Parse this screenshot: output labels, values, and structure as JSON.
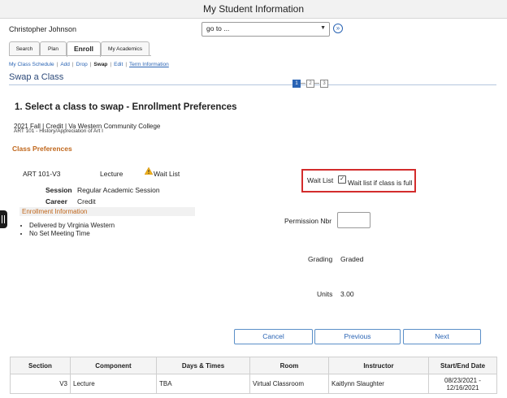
{
  "window": {
    "title": "My Student Information"
  },
  "header": {
    "user_name": "Christopher Johnson",
    "goto_value": "go to ...",
    "go_icon": "go-arrow-icon"
  },
  "tabs": [
    {
      "label": "Search"
    },
    {
      "label": "Plan"
    },
    {
      "label": "Enroll",
      "active": true
    },
    {
      "label": "My Academics"
    }
  ],
  "subnav": {
    "my_class_schedule": "My Class Schedule",
    "add": "Add",
    "drop": "Drop",
    "swap": "Swap",
    "edit": "Edit",
    "term_information": "Term Information",
    "separator": "|"
  },
  "page": {
    "title": "Swap a Class"
  },
  "steps": [
    "1",
    "2",
    "3"
  ],
  "section": {
    "heading": "1.  Select a class to swap - Enrollment Preferences",
    "term_line": "2021 Fall | Credit | Va Western Community College",
    "course_line": "ART  101 - History/Appreciation of Art I"
  },
  "preferences": {
    "title": "Class Preferences",
    "class_id": "ART  101-V3",
    "component": "Lecture",
    "wait_list_status": "Wait List",
    "session_label": "Session",
    "session_value": "Regular Academic Session",
    "career_label": "Career",
    "career_value": "Credit",
    "enrollment_info_title": "Enrollment Information",
    "enrollment_info_items": [
      "Delivered by Virginia Western",
      "No Set Meeting Time"
    ],
    "wait_list_label": "Wait List",
    "wait_list_checkbox_text": "Wait list if class is full",
    "wait_list_checked": true,
    "permission_label": "Permission Nbr",
    "permission_value": "",
    "grading_label": "Grading",
    "grading_value": "Graded",
    "units_label": "Units",
    "units_value": "3.00"
  },
  "buttons": {
    "cancel": "Cancel",
    "previous": "Previous",
    "next": "Next"
  },
  "table": {
    "headers": [
      "Section",
      "Component",
      "Days & Times",
      "Room",
      "Instructor",
      "Start/End Date"
    ],
    "rows": [
      [
        "V3",
        "Lecture",
        "TBA",
        "Virtual Classroom",
        "Kaitlynn Slaughter",
        "08/23/2021 - 12/16/2021"
      ]
    ]
  }
}
